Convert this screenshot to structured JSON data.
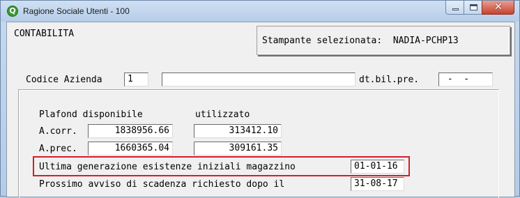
{
  "window": {
    "title": "Ragione Sociale Utenti - 100",
    "app_icon": "Q",
    "close_glyph": "✕"
  },
  "header": {
    "section": "CONTABILITA",
    "printer_label": "Stampante selezionata:",
    "printer_name": "NADIA-PCHP13"
  },
  "company": {
    "code_label": "Codice Azienda",
    "code_value": "1",
    "name_value": "",
    "dtbil_label": "dt.bil.pre.",
    "dtbil_value": " -  -"
  },
  "plafond": {
    "available_label": "Plafond disponibile",
    "used_label": "utilizzato",
    "rows": [
      {
        "label": "A.corr.",
        "available": "1838956.66",
        "used": "313412.10"
      },
      {
        "label": "A.prec.",
        "available": "1660365.04",
        "used": "309161.35"
      }
    ]
  },
  "magazzino": {
    "last_gen_label": "Ultima generazione esistenze iniziali magazzino",
    "last_gen_value": "01-01-16",
    "next_notice_label": "Prossimo avviso di scadenza richiesto dopo il",
    "next_notice_value": "31-08-17"
  },
  "colors": {
    "highlight": "#d21f25",
    "titlebar": "#c6d9ee",
    "close_button": "#c7432f"
  }
}
